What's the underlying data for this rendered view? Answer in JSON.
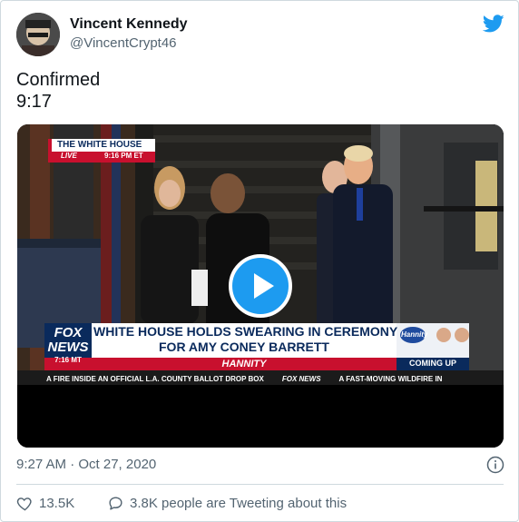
{
  "user": {
    "name": "Vincent Kennedy",
    "handle": "@VincentCrypt46"
  },
  "tweet": {
    "lines": [
      "Confirmed",
      "9:17"
    ]
  },
  "video": {
    "bug_title": "THE WHITE HOUSE",
    "bug_live": "LIVE",
    "bug_time": "9:16 PM ET",
    "channel_top": "FOX",
    "channel_bottom": "NEWS",
    "channel_time": "7:16 MT",
    "headline_line1": "WHITE HOUSE HOLDS SWEARING IN CEREMONY",
    "headline_line2": "FOR AMY CONEY BARRETT",
    "show": "HANNITY",
    "promo_logo": "Hannity",
    "promo_caption": "COMING UP",
    "ticker_left": "A FIRE INSIDE AN OFFICIAL L.A. COUNTY BALLOT DROP BOX",
    "ticker_brand": "FOX NEWS",
    "ticker_right": "A FAST-MOVING WILDFIRE IN"
  },
  "meta": {
    "timestamp": "9:27 AM · Oct 27, 2020"
  },
  "actions": {
    "likes": "13.5K",
    "tweeting": "3.8K people are Tweeting about this"
  },
  "colors": {
    "twitter_blue": "#1d9bf0",
    "fox_red": "#c8102e",
    "fox_navy": "#0a2a5c"
  }
}
